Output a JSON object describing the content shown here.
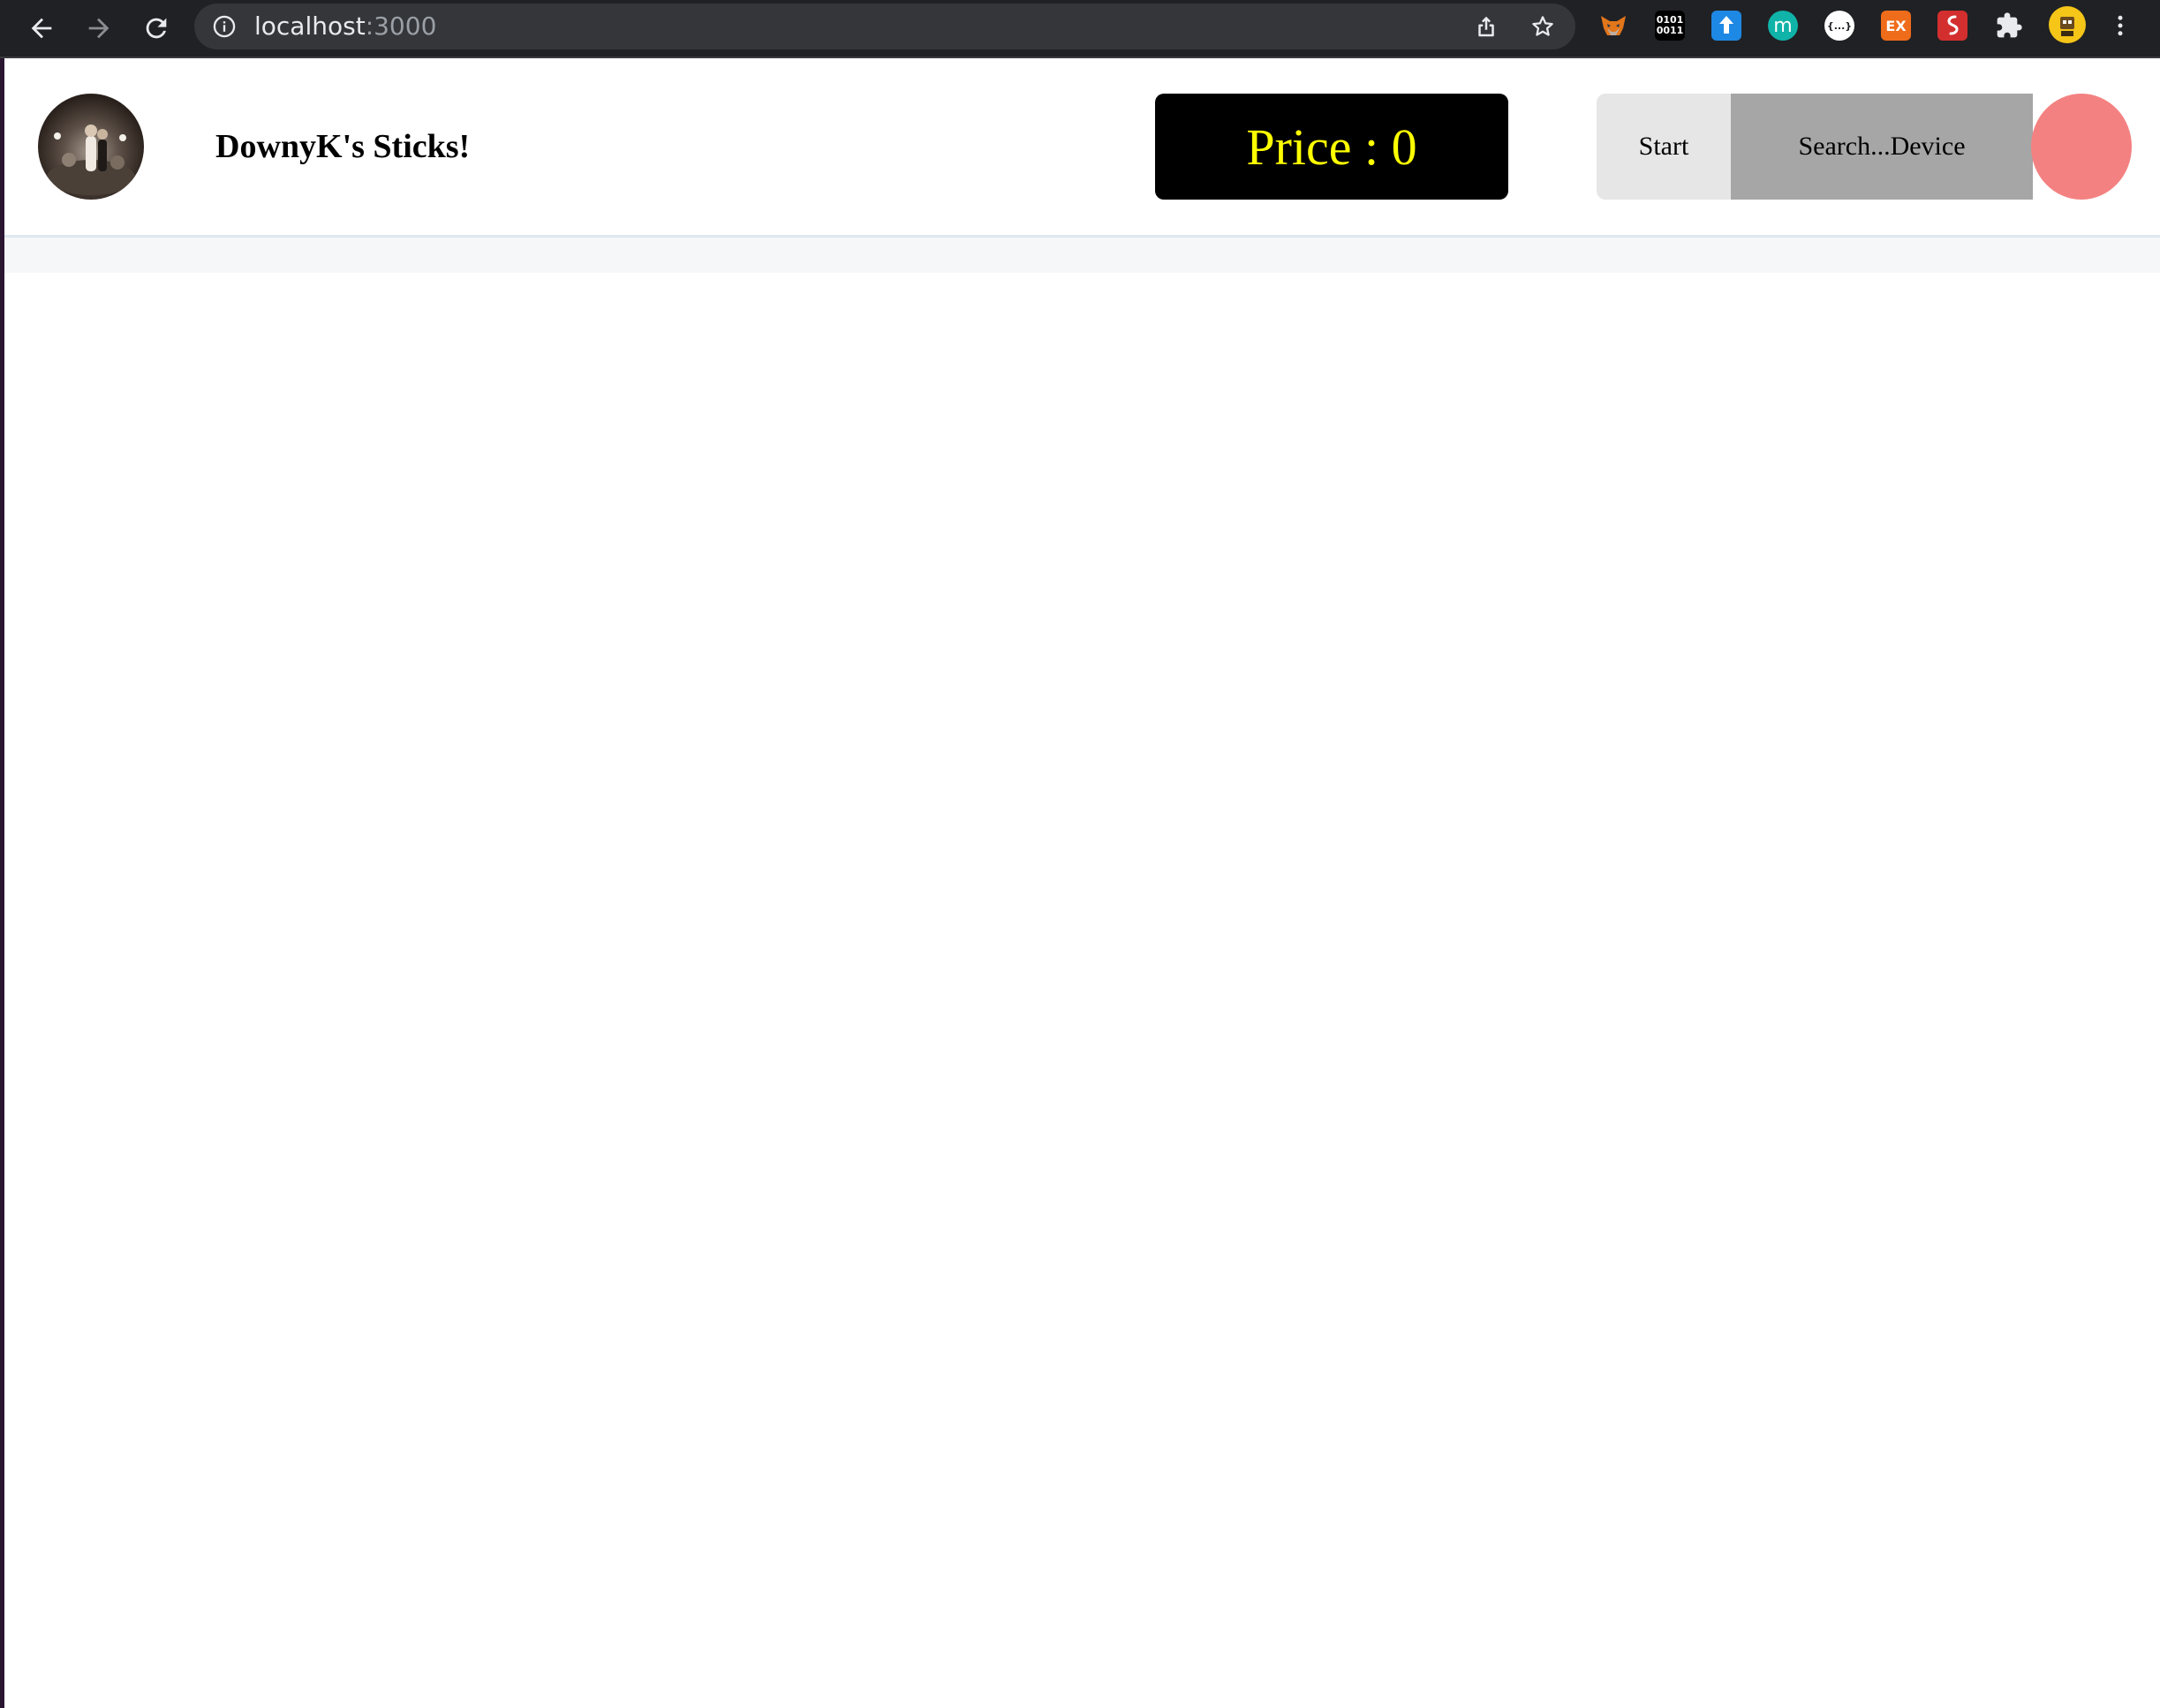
{
  "browser": {
    "url_host": "localhost",
    "url_port": ":3000",
    "extensions": [
      {
        "name": "metamask-fox-icon"
      },
      {
        "name": "binary-extension-icon",
        "text": "0101 0011"
      },
      {
        "name": "blue-upload-extension-icon"
      },
      {
        "name": "m-extension-icon",
        "text": "m"
      },
      {
        "name": "json-viewer-extension-icon",
        "text": "{...}"
      },
      {
        "name": "ex-extension-icon",
        "text": "EX"
      },
      {
        "name": "red-extension-icon"
      },
      {
        "name": "puzzle-extensions-icon"
      }
    ]
  },
  "header": {
    "site_title": "DownyK's Sticks!",
    "price_label": "Price : 0",
    "start_label": "Start",
    "search_label": "Search...Device"
  },
  "colors": {
    "price_bg": "#000000",
    "price_text": "#ffff00",
    "start_bg": "#e6e6e6",
    "search_bg": "#a6a6a6",
    "status_dot": "#f48181"
  }
}
